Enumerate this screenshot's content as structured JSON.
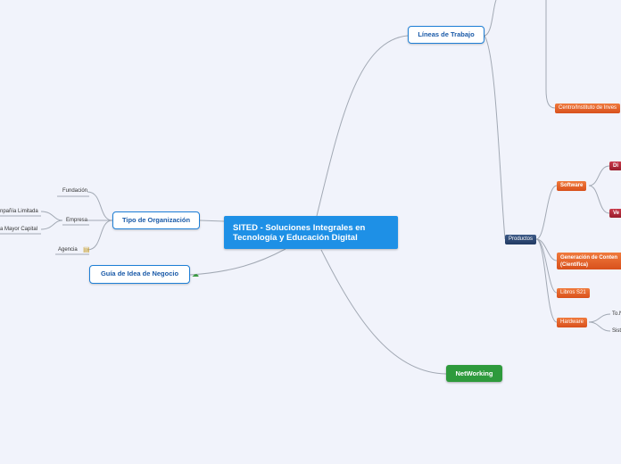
{
  "root": {
    "label_line1": "SITED - Soluciones Integrales en",
    "label_line2": "Tecnología y Educación Digital"
  },
  "lineas": {
    "label": "Líneas de Trabajo"
  },
  "centro": {
    "label": "Centro/Instituto de Inves"
  },
  "productos": {
    "label": "Productos",
    "software": {
      "label": "Software",
      "children": [
        "Di",
        "Ve"
      ]
    },
    "generacion": {
      "line1": "Generación de Conten",
      "line2": "(Científica)"
    },
    "libros": {
      "label": "Libros S21"
    },
    "hardware": {
      "label": "Hardware",
      "children": [
        "To.N",
        "Siste"
      ]
    }
  },
  "networking": {
    "label": "NetWorking"
  },
  "tipo": {
    "label": "Tipo de Organización",
    "children": [
      "Fundación",
      "Empresa",
      "Agencia"
    ],
    "empresa_children": [
      "npañía Limitada",
      "a Mayor Capital"
    ]
  },
  "guia": {
    "label": "Guía de Idea de Negocio"
  },
  "colors": {
    "root": "#1e90e6",
    "topic_border": "#1e7fd6",
    "link": "#9aa4b0",
    "networking": "#2e9a3c"
  },
  "icons": {
    "guia": "cloud-icon",
    "agencia": "building-icon"
  }
}
